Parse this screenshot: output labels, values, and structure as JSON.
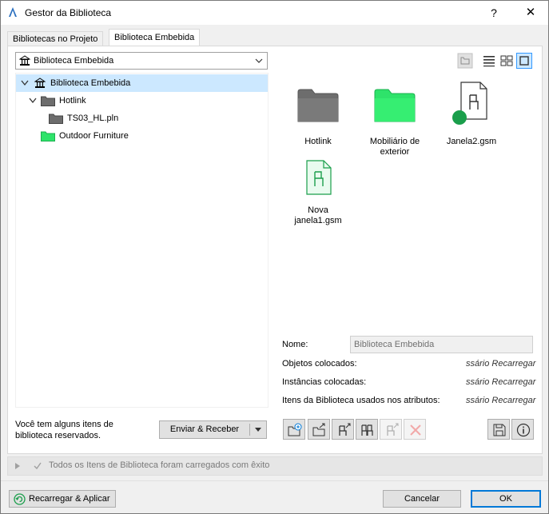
{
  "window": {
    "title": "Gestor da Biblioteca",
    "help_label": "?",
    "close_label": "✕"
  },
  "tabs": [
    {
      "label": "Bibliotecas no Projeto"
    },
    {
      "label": "Biblioteca Embebida"
    }
  ],
  "library_select": {
    "value": "Biblioteca Embebida"
  },
  "tree": [
    {
      "label": "Biblioteca Embebida"
    },
    {
      "label": "Hotlink"
    },
    {
      "label": "TS03_HL.pln"
    },
    {
      "label": "Outdoor Furniture"
    }
  ],
  "tiles": [
    {
      "label": "Hotlink"
    },
    {
      "label_line1": "Mobiliário de",
      "label_line2": "exterior"
    },
    {
      "label": "Janela2.gsm"
    },
    {
      "label_line1": "Nova",
      "label_line2": "janela1.gsm"
    }
  ],
  "info": {
    "name_label": "Nome:",
    "name_value": "Biblioteca Embebida",
    "placed_objects_label": "Objetos colocados:",
    "placed_objects_value": "ssário Recarregar",
    "placed_instances_label": "Instâncias colocadas:",
    "placed_instances_value": "ssário Recarregar",
    "attr_items_label": "Itens da Biblioteca usados nos atributos:",
    "attr_items_value": "ssário Recarregar"
  },
  "reserved": {
    "line1": "Você tem alguns itens de",
    "line2": "biblioteca reservados.",
    "send_receive_label": "Enviar & Receber"
  },
  "status": {
    "message": "Todos os Itens de Biblioteca foram carregados com êxito"
  },
  "footer": {
    "reload_apply_label": "Recarregar & Aplicar",
    "cancel_label": "Cancelar",
    "ok_label": "OK"
  },
  "colors": {
    "accent": "#0078d7",
    "selection": "#cce8ff",
    "folder_gray": "#6d6d6d",
    "folder_green": "#2ee36a",
    "status_dot": "#1a9e4b"
  }
}
